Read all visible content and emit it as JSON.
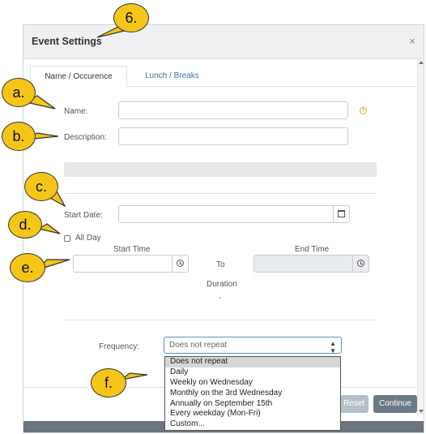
{
  "modal": {
    "title": "Event Settings",
    "close": "×",
    "tabs": [
      {
        "label": "Name / Occurence",
        "active": true
      },
      {
        "label": "Lunch / Breaks",
        "active": false
      }
    ]
  },
  "form": {
    "name_label": "Name:",
    "description_label": "Description:",
    "start_date_label": "Start Date:",
    "all_day_label": "All Day",
    "start_time_label": "Start Time",
    "end_time_label": "End Time",
    "to_label": "To",
    "duration_label": "Duration",
    "duration_value": "-",
    "frequency_label": "Frequency:",
    "frequency_value": "Does not repeat",
    "frequency_options": [
      "Does not repeat",
      "Daily",
      "Weekly on Wednesday",
      "Monthly on the 3rd Wednesday",
      "Annually on September 15th",
      "Every weekday (Mon-Fri)",
      "Custom..."
    ]
  },
  "buttons": {
    "reset": "Reset",
    "continue": "Continue"
  },
  "annotations": {
    "title_num": "6.",
    "a": "a.",
    "b": "b.",
    "c": "c.",
    "d": "d.",
    "e": "e.",
    "f": "f."
  },
  "icons": [
    "info-icon",
    "calendar-icon",
    "clock-icon",
    "chevron-updown-icon",
    "close-icon"
  ],
  "colors": {
    "accent_link": "#3f6fa3",
    "info": "#e8a02a",
    "callout": "#f5c518",
    "continue_btn": "#6c7a86",
    "reset_btn": "#b3c0c8"
  }
}
